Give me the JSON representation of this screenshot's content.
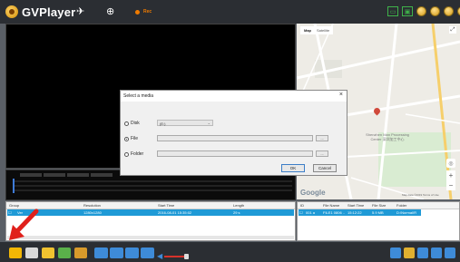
{
  "app": {
    "title": "GVPlayer",
    "rec_text": "Rec"
  },
  "map": {
    "tabs": [
      "Map",
      "Satellite"
    ],
    "place_label": "Shenzhen Man Processing Center 深圳加工中心",
    "google": "Google",
    "footer": "Map data ©2019  Terms of Use"
  },
  "left_list": {
    "headers": [
      "Group",
      "Resolution",
      "Start Time",
      "Length"
    ],
    "row": [
      "Ver",
      "1280x1280",
      "2016-08-01 15:35:02",
      "29 s"
    ]
  },
  "right_list": {
    "headers": [
      "ID",
      "File Name",
      "Start Time",
      "File Size",
      "Folder"
    ],
    "row": [
      "001 a",
      "FILE1 0806 ..",
      "15:12:22",
      "5.9 MB",
      "D:\\Normal\\R"
    ]
  },
  "dialog": {
    "title": "Select a media",
    "options": [
      "Disk",
      "File",
      "Folder"
    ],
    "selected": "File",
    "disk_value": "(E:)",
    "browse_label": "...",
    "ok_label": "OK",
    "cancel_label": "Cancel"
  },
  "colors": {
    "accent_blue": "#1f9ad6",
    "arrow_red": "#e0201b",
    "brand_orange": "#f07b00"
  }
}
